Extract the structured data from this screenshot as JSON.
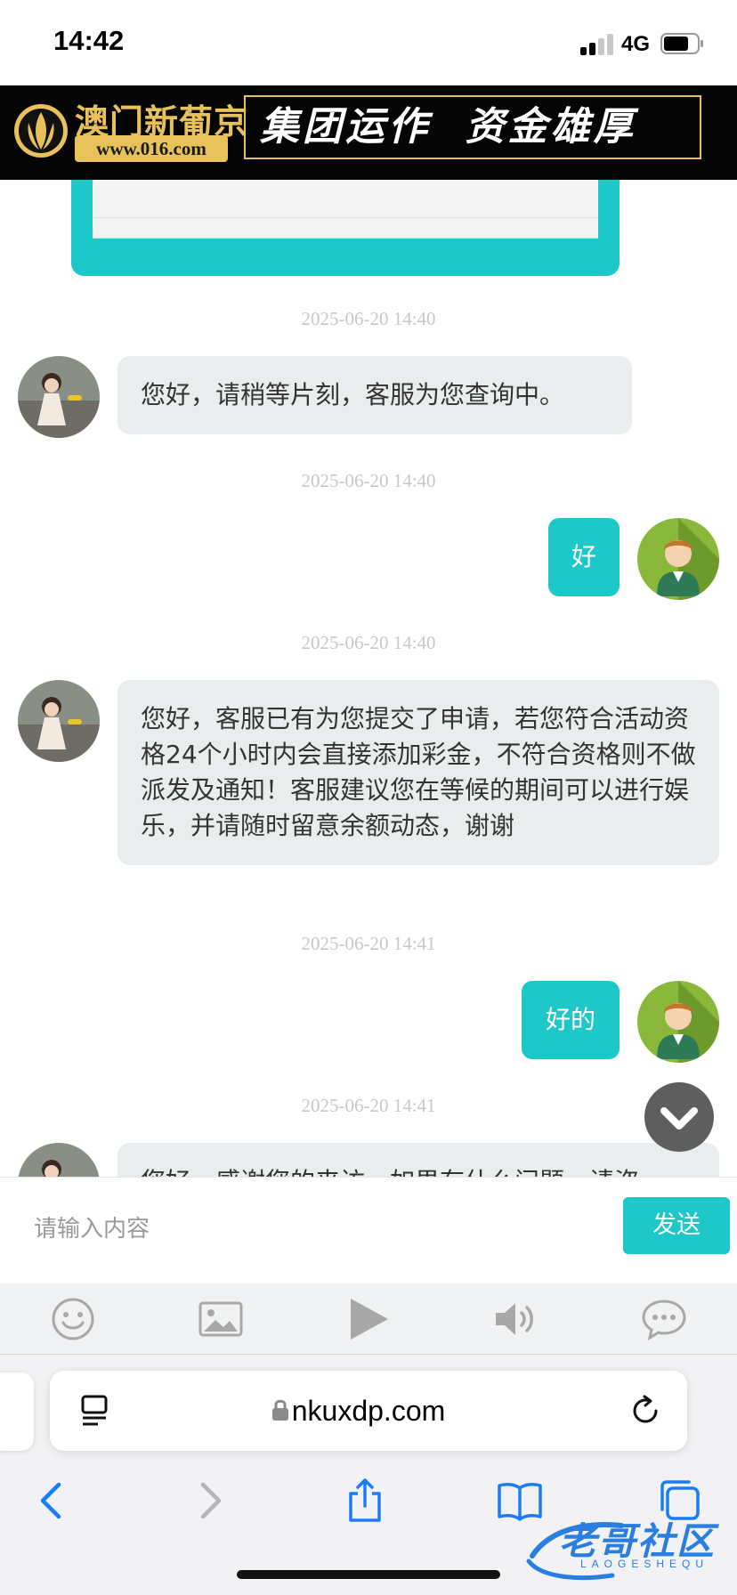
{
  "status_bar": {
    "time": "14:42",
    "network": "4G",
    "signal_bars_active": 2,
    "signal_bars_total": 4,
    "battery_level": 0.75
  },
  "banner": {
    "brand_name": "澳门新葡京",
    "brand_url": "www.016.com",
    "slogan": "集团运作  资金雄厚",
    "accent_color": "#e8c15a"
  },
  "chat": {
    "accent_color": "#1ec8c8",
    "messages": [
      {
        "timestamp": "2025-06-20 14:40",
        "side": "left",
        "text": "您好，请稍等片刻，客服为您查询中。"
      },
      {
        "timestamp": "2025-06-20 14:40",
        "side": "right",
        "text": "好"
      },
      {
        "timestamp": "2025-06-20 14:40",
        "side": "left",
        "text": "您好，客服已有为您提交了申请，若您符合活动资格24个小时内会直接添加彩金，不符合资格则不做派发及通知！客服建议您在等候的期间可以进行娱乐，并请随时留意余额动态，谢谢"
      },
      {
        "timestamp": "2025-06-20 14:41",
        "side": "right",
        "text": "好的"
      },
      {
        "timestamp": "2025-06-20 14:41",
        "side": "left",
        "text": "您好，感谢您的来访，如果有什么问题，请咨"
      }
    ]
  },
  "composer": {
    "placeholder": "请输入内容",
    "send_label": "发送"
  },
  "toolbar": {
    "items": [
      "smiley-icon",
      "image-icon",
      "play-icon",
      "speaker-icon",
      "chat-bubble-icon"
    ]
  },
  "browser": {
    "url": "nkuxdp.com"
  },
  "watermark": {
    "text": "老哥社区",
    "sub": "LAOGESHEQU"
  }
}
